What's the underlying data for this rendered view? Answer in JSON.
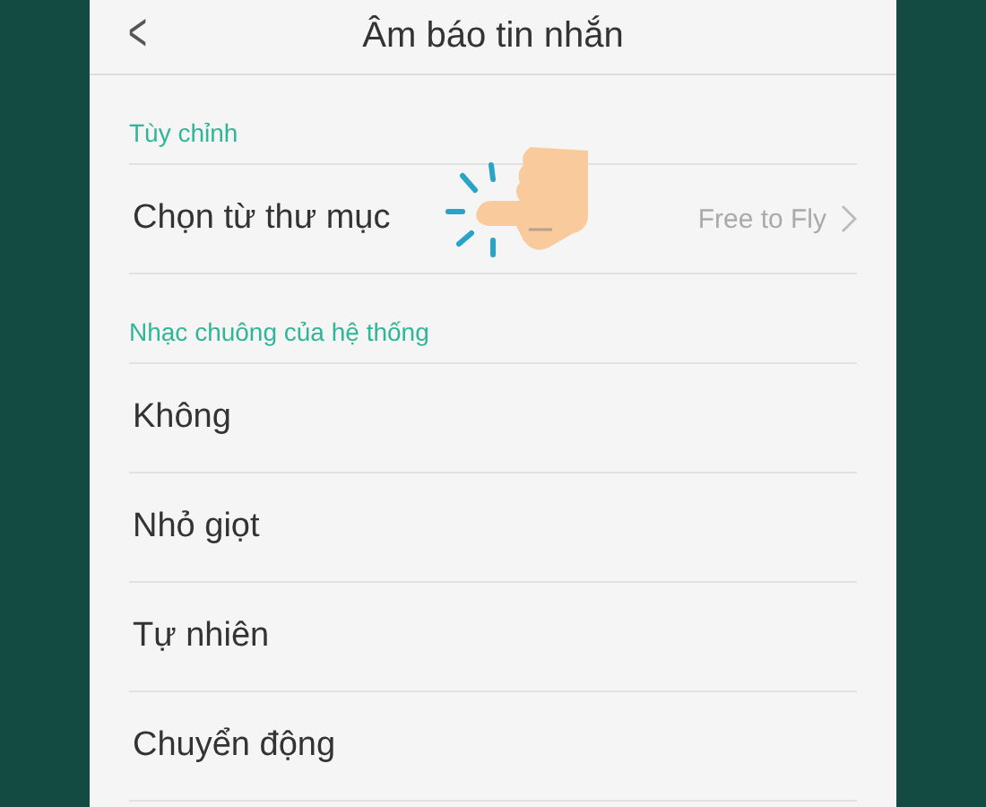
{
  "header": {
    "back_icon": "<",
    "title": "Âm báo tin nhắn"
  },
  "sections": [
    {
      "title": "Tùy chỉnh",
      "items": [
        {
          "label": "Chọn từ thư mục",
          "value": "Free to Fly"
        }
      ]
    },
    {
      "title": "Nhạc chuông của hệ thống",
      "items": [
        {
          "label": "Không"
        },
        {
          "label": "Nhỏ giọt"
        },
        {
          "label": "Tự nhiên"
        },
        {
          "label": "Chuyển động"
        }
      ]
    }
  ]
}
